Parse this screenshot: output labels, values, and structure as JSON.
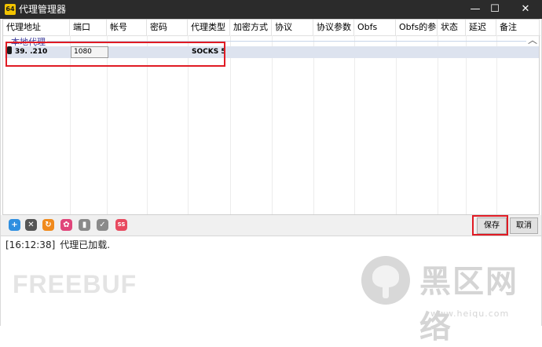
{
  "window": {
    "title": "代理管理器",
    "app_icon_text": "64",
    "controls": {
      "minimize": "—",
      "maximize": "☐",
      "close": "✕"
    }
  },
  "table": {
    "columns": [
      "代理地址",
      "端口",
      "帐号",
      "密码",
      "代理类型",
      "加密方式",
      "协议",
      "协议参数",
      "Obfs",
      "Obfs的参...",
      "状态",
      "延迟",
      "备注"
    ],
    "group_label": "本地代理",
    "collapse_glyph": "︿",
    "rows": [
      {
        "address": "39.       .210",
        "port": "1080",
        "account": "",
        "password": "",
        "type": "SOCKS 5",
        "encryption": "",
        "protocol": "",
        "protocol_param": "",
        "obfs": "",
        "obfs_param": "",
        "status": "",
        "latency": "",
        "note": ""
      }
    ]
  },
  "toolbar": {
    "icons": [
      {
        "name": "add-icon",
        "glyph": "+",
        "color": "#2f8fe0"
      },
      {
        "name": "delete-icon",
        "glyph": "✕",
        "color": "#555555"
      },
      {
        "name": "refresh-icon",
        "glyph": "↻",
        "color": "#f08a1c"
      },
      {
        "name": "settings-icon",
        "glyph": "✿",
        "color": "#e0457a"
      },
      {
        "name": "database-icon",
        "glyph": "▮",
        "color": "#8a8a8a"
      },
      {
        "name": "check-icon",
        "glyph": "✓",
        "color": "#8a8a8a"
      },
      {
        "name": "ss-icon",
        "glyph": "SS",
        "color": "#e84a5f"
      }
    ],
    "save_label": "保存",
    "cancel_label": "取消"
  },
  "log": {
    "time": "[16:12:38]",
    "message": "代理已加载."
  },
  "watermarks": {
    "left": "FREEBUF",
    "right_cn": "黑区网络",
    "right_url": "www.heiqu.com"
  },
  "colors": {
    "highlight": "#e01b24",
    "titlebar": "#2b2b2b",
    "selected_row": "#dde3ef"
  }
}
